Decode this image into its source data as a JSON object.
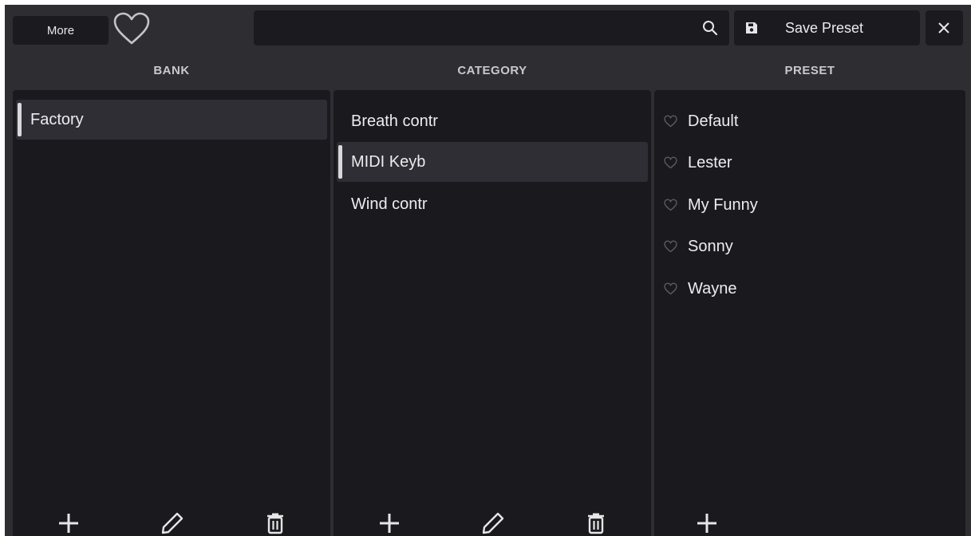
{
  "topbar": {
    "more_label": "More",
    "search_value": "",
    "search_placeholder": "",
    "save_label": "Save Preset"
  },
  "columns": {
    "bank": {
      "header": "BANK",
      "items": [
        "Factory"
      ],
      "selected": "Factory"
    },
    "category": {
      "header": "CATEGORY",
      "items": [
        "Breath contr",
        "MIDI Keyb",
        "Wind contr"
      ],
      "selected": "MIDI Keyb"
    },
    "preset": {
      "header": "PRESET",
      "items": [
        "Default",
        "Lester",
        "My Funny",
        "Sonny",
        "Wayne"
      ]
    }
  },
  "icons": {
    "favorite": "heart-outline-icon",
    "search": "search-icon",
    "save": "floppy-disk-icon",
    "close": "close-icon",
    "add": "plus-icon",
    "edit": "pencil-icon",
    "delete": "trash-icon"
  },
  "colors": {
    "background": "#2d2d32",
    "panel": "#1a1a1e",
    "selected_row": "#2e2e34",
    "text": "#ededef"
  }
}
